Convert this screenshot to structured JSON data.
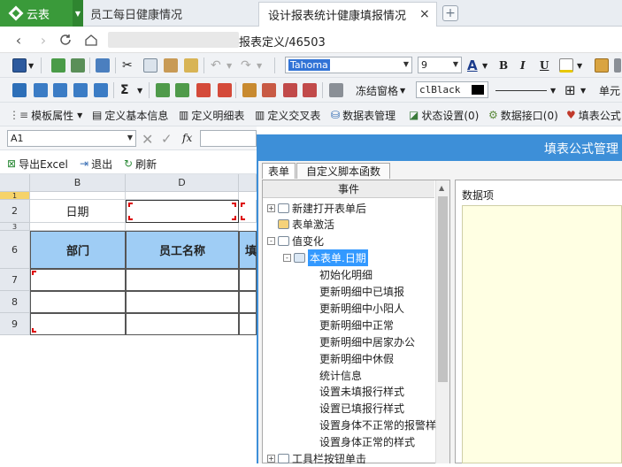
{
  "tabs": {
    "app_name": "云表",
    "tab1_label": "员工每日健康情况",
    "tab2_label": "设计报表统计健康填报情况",
    "close_glyph": "×",
    "new_tab_glyph": "+"
  },
  "address": {
    "url_visible": "报表定义/46503"
  },
  "toolbar1": {
    "font_name": "Tahoma",
    "font_size": "9",
    "bold": "B",
    "italic": "I",
    "underline": "U"
  },
  "toolbar2": {
    "sigma": "Σ",
    "freeze_label": "冻结窗格",
    "color_name": "clBlack",
    "cell_label": "单元"
  },
  "toolbar3": {
    "template_props": "模板属性",
    "define_basic": "定义基本信息",
    "define_detail": "定义明细表",
    "define_cross": "定义交叉表",
    "datasheet_mgmt": "数据表管理",
    "status_settings": "状态设置(0)",
    "data_interface": "数据接口(0)",
    "fill_formula": "填表公式"
  },
  "formula_bar": {
    "cell_ref": "A1",
    "fx": "fx"
  },
  "sheet_toolbar": {
    "export_excel": "导出Excel",
    "exit": "退出",
    "refresh": "刷新"
  },
  "sheet": {
    "col_b": "B",
    "col_d": "D",
    "rows": [
      "1",
      "2",
      "3",
      "6",
      "7",
      "8",
      "9"
    ],
    "date_label": "日期",
    "dept_header": "部门",
    "employee_header": "员工名称",
    "partial_header": "填"
  },
  "dialog": {
    "title": "填表公式管理",
    "tab_form": "表单",
    "tab_script": "自定义脚本函数",
    "events_header": "事件",
    "data_items_label": "数据项",
    "tree": [
      {
        "label": "新建打开表单后",
        "level": 0,
        "toggle": "+"
      },
      {
        "label": "表单激活",
        "level": 0,
        "toggle": ""
      },
      {
        "label": "值变化",
        "level": 0,
        "toggle": "-"
      },
      {
        "label": "本表单.日期",
        "level": 1,
        "toggle": "-"
      },
      {
        "label": "初始化明细",
        "level": 2,
        "toggle": ""
      },
      {
        "label": "更新明细中已填报",
        "level": 2,
        "toggle": ""
      },
      {
        "label": "更新明细中小阳人",
        "level": 2,
        "toggle": ""
      },
      {
        "label": "更新明细中正常",
        "level": 2,
        "toggle": ""
      },
      {
        "label": "更新明细中居家办公",
        "level": 2,
        "toggle": ""
      },
      {
        "label": "更新明细中休假",
        "level": 2,
        "toggle": ""
      },
      {
        "label": "统计信息",
        "level": 2,
        "toggle": ""
      },
      {
        "label": "设置未填报行样式",
        "level": 2,
        "toggle": ""
      },
      {
        "label": "设置已填报行样式",
        "level": 2,
        "toggle": ""
      },
      {
        "label": "设置身体不正常的报警样",
        "level": 2,
        "toggle": ""
      },
      {
        "label": "设置身体正常的样式",
        "level": 2,
        "toggle": ""
      },
      {
        "label": "工具栏按钮单击",
        "level": 0,
        "toggle": "+"
      }
    ]
  },
  "colors": {
    "brand_green": "#3a9a3a",
    "dialog_blue": "#3d8fd8",
    "header_blue": "#9fcdf5",
    "selected_node": "#3399ff",
    "data_panel_yellow": "#ffffe3"
  }
}
